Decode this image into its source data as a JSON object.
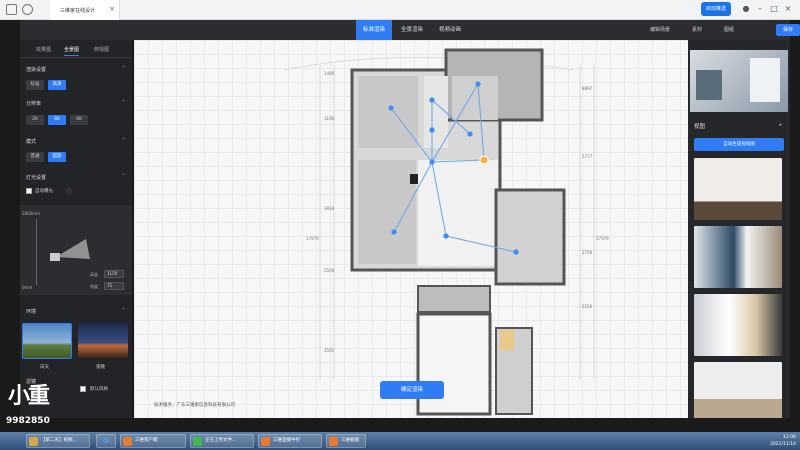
{
  "browser": {
    "tab_title": "三维家在线设计",
    "share_label": "启动推送"
  },
  "toolbar": {
    "modes": [
      "标准渲染",
      "全景渲染",
      "视频动画"
    ],
    "actions": [
      "编辑场景",
      "素材",
      "图纸"
    ],
    "save_label": "保存"
  },
  "left_panel": {
    "tabs": [
      "效果图",
      "全景图",
      "俯视图"
    ],
    "active_tab": 1,
    "sections": {
      "render_settings": "渲染设置",
      "quality_label": "分辨率",
      "quality_options": [
        "2K",
        "4K",
        "6K"
      ],
      "mode_label": "模式",
      "mode_options": [
        "普通",
        "超高"
      ],
      "quality_row_options": [
        "标准",
        "高清"
      ],
      "light_label": "灯光设置",
      "auto_exposure": "自动曝光",
      "env_label": "环境",
      "env_options": [
        "白天",
        "夜晚"
      ],
      "filter_label": "滤镜",
      "filter_option": "默认风格"
    },
    "camera": {
      "top_label": "2800mm",
      "bottom_label": "0mm",
      "height_label": "高度",
      "height_value": "1150",
      "angle_label": "角度",
      "angle_value": "75"
    }
  },
  "canvas": {
    "confirm_label": "确定渲染",
    "copyright": "技术服务：广东三维家信息科技有限公司",
    "dimensions": [
      "1490",
      "3190",
      "3934",
      "5504",
      "17979",
      "17979",
      "8897",
      "5777",
      "2759",
      "2156",
      "3591"
    ]
  },
  "right_panel": {
    "scene_header": "视图",
    "auto_generate": "自动生成视角图"
  },
  "watermark": {
    "logo": "小重",
    "code": "9982850"
  },
  "taskbar": {
    "items": [
      "【第二天】视频...",
      "三维客户端",
      "正在上传文件...",
      "三维直播中控",
      "三维截图"
    ],
    "time": "12:06",
    "date": "2021/11/16"
  },
  "colors": {
    "accent": "#2f7cf6",
    "panel": "#232427"
  }
}
